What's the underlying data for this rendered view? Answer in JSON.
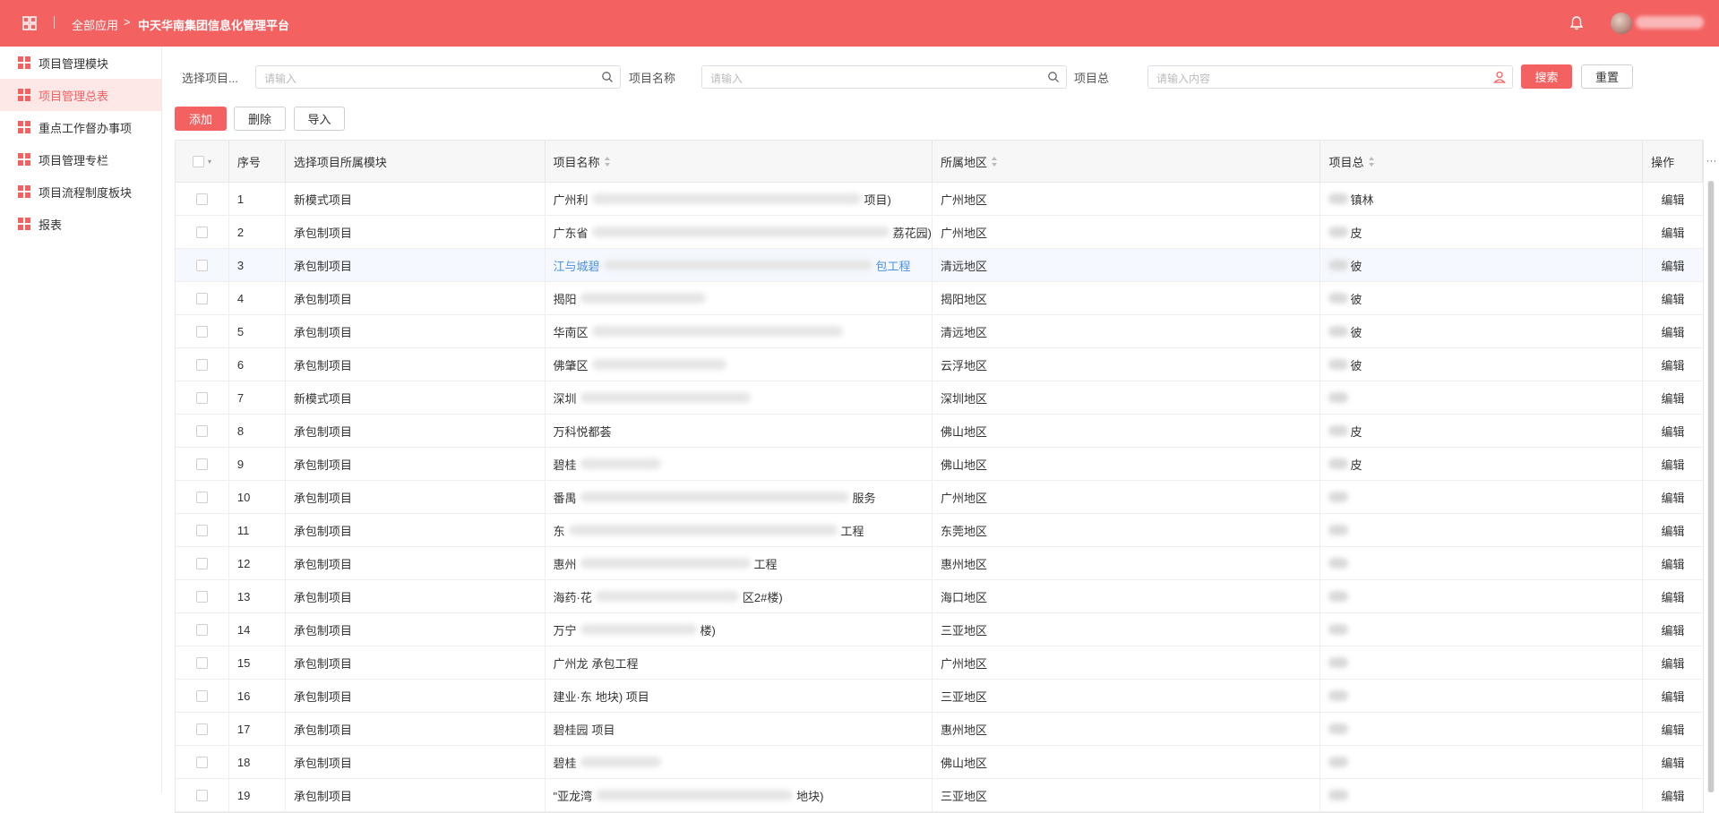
{
  "header": {
    "breadcrumb_home": "全部应用",
    "breadcrumb_arrow": ">",
    "breadcrumb_current": "中天华南集团信息化管理平台"
  },
  "sidebar": {
    "items": [
      {
        "label": "项目管理模块"
      },
      {
        "label": "项目管理总表"
      },
      {
        "label": "重点工作督办事项"
      },
      {
        "label": "项目管理专栏"
      },
      {
        "label": "项目流程制度板块"
      },
      {
        "label": "报表"
      }
    ],
    "active_index": 1
  },
  "filters": {
    "module_label": "选择项目...",
    "module_placeholder": "请输入",
    "name_label": "项目名称",
    "name_placeholder": "请输入",
    "total_label": "项目总",
    "total_placeholder": "请输入内容",
    "search_label": "搜索",
    "reset_label": "重置"
  },
  "toolbar": {
    "add_label": "添加",
    "delete_label": "删除",
    "import_label": "导入"
  },
  "table": {
    "columns": {
      "no": "序号",
      "module": "选择项目所属模块",
      "name": "项目名称",
      "area": "所属地区",
      "total": "项目总",
      "op": "操作"
    },
    "more": "···",
    "edit_label": "编辑",
    "rows": [
      {
        "no": "1",
        "module": "新模式项目",
        "name_a": "广州利",
        "name_b": "项目)",
        "area": "广州地区",
        "total": "镇林"
      },
      {
        "no": "2",
        "module": "承包制项目",
        "name_a": "广东省",
        "name_b": "荔花园)",
        "area": "广州地区",
        "total": "皮"
      },
      {
        "no": "3",
        "module": "承包制项目",
        "name_a": "江与城碧",
        "name_b": "包工程",
        "area": "清远地区",
        "total": "彼"
      },
      {
        "no": "4",
        "module": "承包制项目",
        "name_a": "揭阳",
        "name_b": "",
        "area": "揭阳地区",
        "total": "彼"
      },
      {
        "no": "5",
        "module": "承包制项目",
        "name_a": "华南区",
        "name_b": "",
        "area": "清远地区",
        "total": "彼"
      },
      {
        "no": "6",
        "module": "承包制项目",
        "name_a": "佛肇区",
        "name_b": "",
        "area": "云浮地区",
        "total": "彼"
      },
      {
        "no": "7",
        "module": "新模式项目",
        "name_a": "深圳",
        "name_b": "",
        "area": "深圳地区",
        "total": ""
      },
      {
        "no": "8",
        "module": "承包制项目",
        "name_a": "万科悦都荟",
        "name_b": "",
        "area": "佛山地区",
        "total": "皮"
      },
      {
        "no": "9",
        "module": "承包制项目",
        "name_a": "碧桂",
        "name_b": "",
        "area": "佛山地区",
        "total": "皮"
      },
      {
        "no": "10",
        "module": "承包制项目",
        "name_a": "番禺",
        "name_b": "服务",
        "area": "广州地区",
        "total": ""
      },
      {
        "no": "11",
        "module": "承包制项目",
        "name_a": "东",
        "name_b": "工程",
        "area": "东莞地区",
        "total": ""
      },
      {
        "no": "12",
        "module": "承包制项目",
        "name_a": "惠州",
        "name_b": "工程",
        "area": "惠州地区",
        "total": ""
      },
      {
        "no": "13",
        "module": "承包制项目",
        "name_a": "海药·花",
        "name_b": "区2#楼)",
        "area": "海口地区",
        "total": ""
      },
      {
        "no": "14",
        "module": "承包制项目",
        "name_a": "万宁",
        "name_b": "楼)",
        "area": "三亚地区",
        "total": ""
      },
      {
        "no": "15",
        "module": "承包制项目",
        "name_a": "广州龙",
        "name_b": "承包工程",
        "area": "广州地区",
        "total": ""
      },
      {
        "no": "16",
        "module": "承包制项目",
        "name_a": "建业·东",
        "name_b": "地块) 项目",
        "area": "三亚地区",
        "total": ""
      },
      {
        "no": "17",
        "module": "承包制项目",
        "name_a": "碧桂园",
        "name_b": "项目",
        "area": "惠州地区",
        "total": ""
      },
      {
        "no": "18",
        "module": "承包制项目",
        "name_a": "碧桂",
        "name_b": "",
        "area": "佛山地区",
        "total": ""
      },
      {
        "no": "19",
        "module": "承包制项目",
        "name_a": "\"亚龙湾",
        "name_b": "地块)",
        "area": "三亚地区",
        "total": ""
      }
    ]
  },
  "colors": {
    "brand": "#f46161",
    "link": "#4a90e2",
    "active_bg": "#fde7e7"
  }
}
